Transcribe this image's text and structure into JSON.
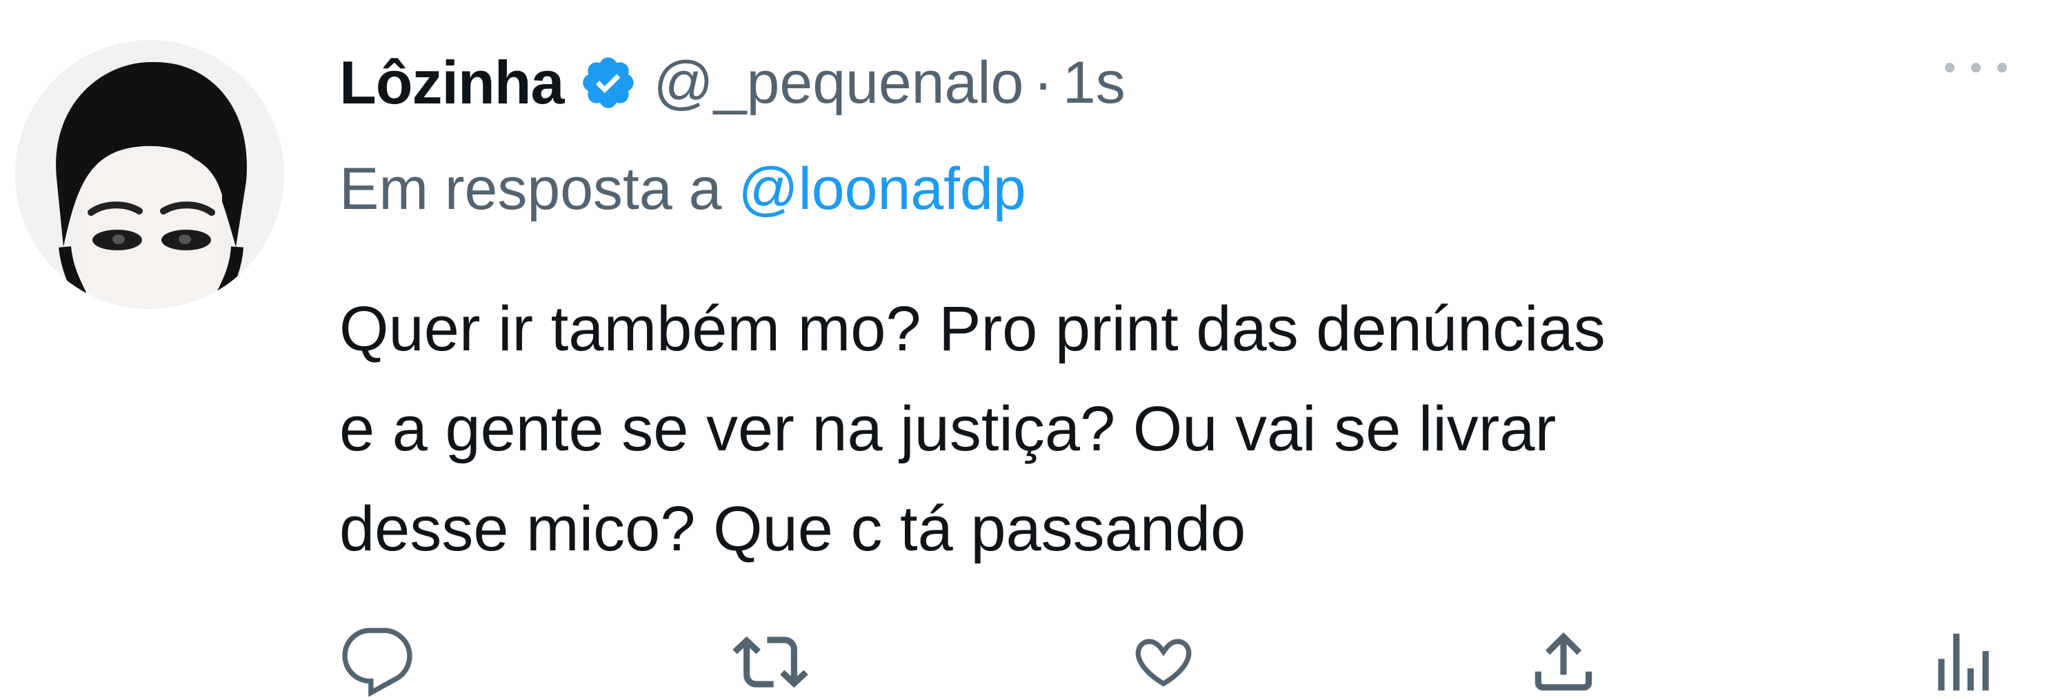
{
  "tweet": {
    "author_name": "Lôzinha",
    "handle": "@_pequenalo",
    "separator": "·",
    "time": "1s",
    "reply_prefix": "Em resposta a",
    "reply_to": "@loonafdp",
    "text_lines": [
      "Quer ir também mo? Pro print das denúncias",
      "e a gente se ver na justiça? Ou vai se livrar",
      "desse mico? Que c tá passando"
    ],
    "verified": true
  },
  "icons": {
    "avatar": "profile-photo",
    "verified": "verified-badge-icon",
    "more": "more-horizontal-icon",
    "reply": "reply-icon",
    "retweet": "retweet-icon",
    "like": "heart-icon",
    "share": "share-icon",
    "analytics": "analytics-icon"
  },
  "colors": {
    "text_primary": "#0f1419",
    "text_secondary": "#536471",
    "link": "#1d9bf0",
    "verified": "#1d9bf0"
  }
}
